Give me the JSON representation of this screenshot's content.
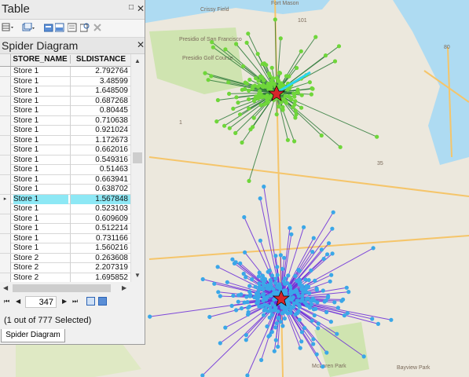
{
  "window": {
    "title": "Table"
  },
  "toolbar": {
    "buttons": [
      {
        "name": "table-options-icon"
      },
      {
        "name": "related-tables-icon"
      },
      {
        "name": "select-by-attributes-icon"
      },
      {
        "name": "switch-selection-icon"
      },
      {
        "name": "clear-selection-icon"
      },
      {
        "name": "zoom-to-selected-icon"
      },
      {
        "name": "delete-selected-icon"
      }
    ]
  },
  "tab_panel": {
    "title": "Spider Diagram"
  },
  "table": {
    "columns": [
      "STORE_NAME",
      "SLDISTANCE"
    ],
    "rows": [
      {
        "store": "Store 1",
        "distance": "2.792764"
      },
      {
        "store": "Store 1",
        "distance": "3.48599"
      },
      {
        "store": "Store 1",
        "distance": "1.648509"
      },
      {
        "store": "Store 1",
        "distance": "0.687268"
      },
      {
        "store": "Store 1",
        "distance": "0.80445"
      },
      {
        "store": "Store 1",
        "distance": "0.710638"
      },
      {
        "store": "Store 1",
        "distance": "0.921024"
      },
      {
        "store": "Store 1",
        "distance": "1.172673"
      },
      {
        "store": "Store 1",
        "distance": "0.662016"
      },
      {
        "store": "Store 1",
        "distance": "0.549316"
      },
      {
        "store": "Store 1",
        "distance": "0.51463"
      },
      {
        "store": "Store 1",
        "distance": "0.663941"
      },
      {
        "store": "Store 1",
        "distance": "0.638702"
      },
      {
        "store": "Store 1",
        "distance": "1.567848"
      },
      {
        "store": "Store 1",
        "distance": "0.523103"
      },
      {
        "store": "Store 1",
        "distance": "0.609609"
      },
      {
        "store": "Store 1",
        "distance": "0.512214"
      },
      {
        "store": "Store 1",
        "distance": "0.731166"
      },
      {
        "store": "Store 1",
        "distance": "1.560216"
      },
      {
        "store": "Store 2",
        "distance": "0.263608"
      },
      {
        "store": "Store 2",
        "distance": "2.207319"
      },
      {
        "store": "Store 2",
        "distance": "1.695852"
      }
    ]
  },
  "navigation": {
    "record": "347"
  },
  "status": {
    "selection": "(1 out of 777 Selected)"
  },
  "bottom_tab": {
    "label": "Spider Diagram"
  },
  "map": {
    "labels": [
      "Presidio of San Francisco",
      "Presidio Golf Course",
      "Crissy Field",
      "Fort Mason",
      "101",
      "80",
      "1",
      "35",
      "McLaren Park",
      "Bayview Park"
    ],
    "colors": {
      "store1_lines": "#2f7a3a",
      "store1_points": "#6fd63a",
      "store2_lines": "#6a2bd8",
      "store2_points": "#3aa7e8",
      "store_marker": "#d7262a",
      "selected_line": "#29d6f0"
    }
  }
}
